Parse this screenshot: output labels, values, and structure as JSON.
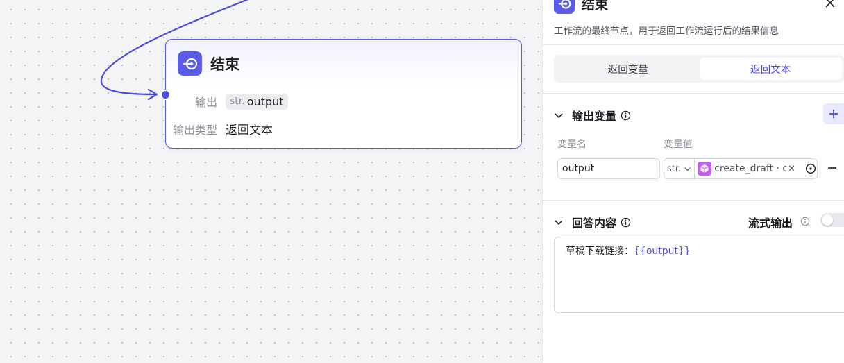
{
  "node": {
    "title": "结束",
    "output_label": "输出",
    "output_type": "str.",
    "output_name": "output",
    "return_type_label": "输出类型",
    "return_type_value": "返回文本"
  },
  "panel": {
    "title": "结束",
    "description": "工作流的最终节点，用于返回工作流运行后的结果信息",
    "tabs": [
      {
        "label": "返回变量",
        "active": false
      },
      {
        "label": "返回文本",
        "active": true
      }
    ],
    "output_section": {
      "title": "输出变量",
      "col_name": "变量名",
      "col_value": "变量值",
      "variable": {
        "name": "output",
        "type": "str.",
        "ref": "create_draft · output"
      }
    },
    "answer_section": {
      "title": "回答内容",
      "stream_label": "流式输出",
      "stream_enabled": false,
      "content_prefix": "草稿下载链接：",
      "content_var": "{{output}}"
    }
  },
  "colors": {
    "accent": "#4b4be0",
    "node_icon": "#5b5be8",
    "plugin_icon": "#c060e8"
  }
}
